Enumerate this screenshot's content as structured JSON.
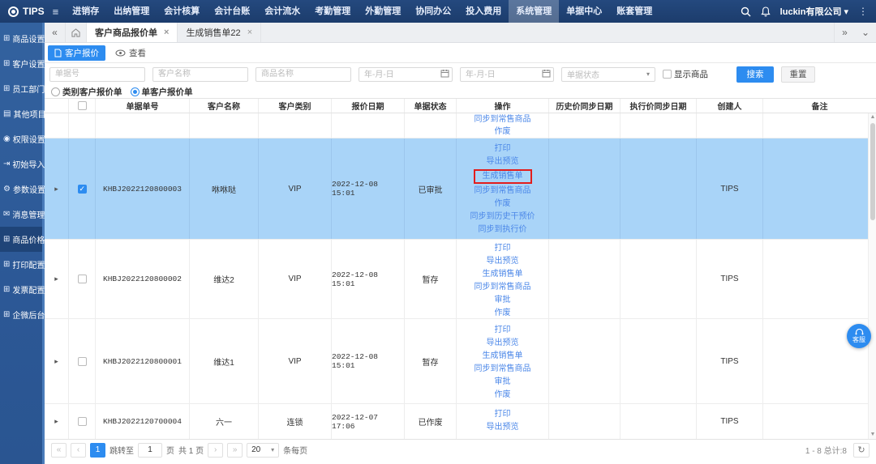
{
  "topbar": {
    "logo": "TIPS",
    "menu": [
      "进销存",
      "出纳管理",
      "会计核算",
      "会计台账",
      "会计流水",
      "考勤管理",
      "外勤管理",
      "协同办公",
      "投入费用",
      "系统管理",
      "单据中心",
      "账套管理"
    ],
    "company": "luckin有限公司"
  },
  "sidebar": {
    "items": [
      "商品设置",
      "客户设置",
      "员工部门",
      "其他项目",
      "权限设置",
      "初始导入",
      "参数设置",
      "消息管理",
      "商品价格",
      "打印配置",
      "发票配置",
      "企微后台"
    ]
  },
  "tabs": {
    "tab1": "客户商品报价单",
    "tab2": "生成销售单22"
  },
  "toolbar": {
    "new_button": "客户报价",
    "view_button": "查看"
  },
  "filters": {
    "doc_no_ph": "单据号",
    "customer_ph": "客户名称",
    "product_ph": "商品名称",
    "date_ph": "年-月-日",
    "status_ph": "单据状态",
    "show_product": "显示商品",
    "search": "搜索",
    "reset": "重置"
  },
  "radios": {
    "r1": "类别客户报价单",
    "r2": "单客户报价单"
  },
  "table": {
    "columns": [
      "单据单号",
      "客户名称",
      "客户类别",
      "报价日期",
      "单据状态",
      "操作",
      "历史价同步日期",
      "执行价同步日期",
      "创建人",
      "备注"
    ],
    "partial": {
      "ops": [
        "同步到常售商品",
        "作废"
      ]
    },
    "rows": [
      {
        "doc_no": "KHBJ2022120800003",
        "customer": "咻咻哒",
        "type": "VIP",
        "date": "2022-12-08 15:01",
        "status": "已审批",
        "creator": "TIPS",
        "ops": [
          "打印",
          "导出预览",
          "生成销售单",
          "同步到常售商品",
          "作废",
          "同步到历史干预价",
          "同步到执行价"
        ]
      },
      {
        "doc_no": "KHBJ2022120800002",
        "customer": "维达2",
        "type": "VIP",
        "date": "2022-12-08 15:01",
        "status": "暂存",
        "creator": "TIPS",
        "ops": [
          "打印",
          "导出预览",
          "生成销售单",
          "同步到常售商品",
          "审批",
          "作废"
        ]
      },
      {
        "doc_no": "KHBJ2022120800001",
        "customer": "维达1",
        "type": "VIP",
        "date": "2022-12-08 15:01",
        "status": "暂存",
        "creator": "TIPS",
        "ops": [
          "打印",
          "导出预览",
          "生成销售单",
          "同步到常售商品",
          "审批",
          "作废"
        ]
      },
      {
        "doc_no": "KHBJ2022120700004",
        "customer": "六一",
        "type": "连锁",
        "date": "2022-12-07 17:06",
        "status": "已作废",
        "creator": "TIPS",
        "ops": [
          "打印",
          "导出预览"
        ]
      }
    ]
  },
  "pagination": {
    "page": "1",
    "goto": "跳转至",
    "goto_value": "1",
    "unit": "页",
    "total": "共 1 页",
    "size": "20",
    "per_page": "条每页",
    "range": "1 - 8 总计:8"
  },
  "floating": {
    "service": "客服"
  },
  "icons": {
    "grid": "⊞",
    "folder": "▤",
    "shield": "◉",
    "import": "⇥",
    "gear": "⚙",
    "message": "✉",
    "hamburger": "≡",
    "dots": "⋮",
    "caret_down": "▾",
    "chevron_left": "«",
    "chevron_right": "»",
    "chevron_down": "⌄",
    "close": "×",
    "expand": "▸",
    "refresh": "↻",
    "first": "«",
    "prev": "‹",
    "next": "›",
    "last": "»",
    "arrow_up": "▲",
    "arrow_down": "▼"
  },
  "colors": {
    "topbar": "#1c3c6c",
    "sidebar": "#2c5896",
    "accent": "#2d8cf0",
    "selected_row": "#a9d4f8",
    "link": "#4b87e8",
    "annotation": "#e21d1d"
  }
}
